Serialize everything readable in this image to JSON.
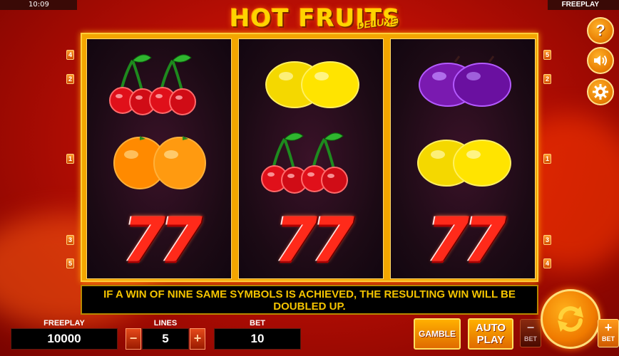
{
  "status_bar": {
    "time": "10:09",
    "mode": "FREEPLAY"
  },
  "logo": {
    "title": "HOT FRUITS",
    "subtitle": "DELUXE"
  },
  "reels": [
    {
      "symbols": [
        "cherries",
        "oranges",
        "sevens"
      ]
    },
    {
      "symbols": [
        "lemons",
        "cherries",
        "sevens"
      ]
    },
    {
      "symbols": [
        "plums",
        "lemons",
        "sevens"
      ]
    }
  ],
  "seven_glyph": "77",
  "line_markers": {
    "left": [
      "4",
      "2",
      "1",
      "3",
      "5"
    ],
    "right": [
      "5",
      "2",
      "1",
      "3",
      "4"
    ]
  },
  "message": "IF A WIN OF NINE SAME SYMBOLS IS ACHIEVED, THE RESULTING WIN WILL BE DOUBLED UP.",
  "panel": {
    "balance_label": "FREEPLAY",
    "balance_value": "10000",
    "lines_label": "LINES",
    "lines_value": "5",
    "bet_label": "BET",
    "bet_value": "10",
    "minus": "−",
    "plus": "+"
  },
  "buttons": {
    "gamble": "GAMBLE",
    "auto_line1": "AUTO",
    "auto_line2": "PLAY",
    "bet_minus_sign": "−",
    "bet_plus_sign": "+",
    "bet_word": "BET",
    "help": "?"
  },
  "icons": {
    "help": "question-icon",
    "sound": "speaker-icon",
    "settings": "gear-icon",
    "spin": "spin-arrows-icon"
  },
  "colors": {
    "background": "#c8140a",
    "frame": "#f3a600",
    "message_text": "#f4c400",
    "accent_orange": "#f08000"
  }
}
